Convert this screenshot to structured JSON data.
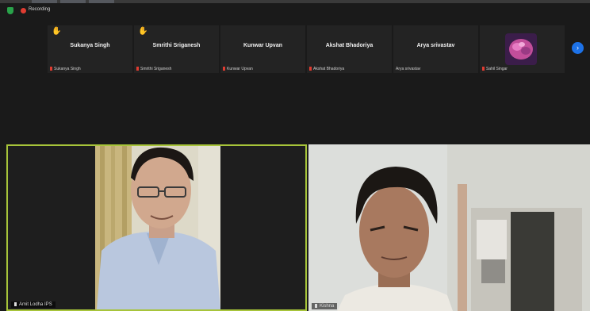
{
  "window": {
    "recording_label": "Recording"
  },
  "participants": [
    {
      "name": "Sukanya Singh",
      "caption": "Sukanya Singh",
      "hand_raised": true,
      "has_avatar": false
    },
    {
      "name": "Smrithi Sriganesh",
      "caption": "Smrithi Sriganesh",
      "hand_raised": true,
      "has_avatar": false
    },
    {
      "name": "Kunwar Upvan",
      "caption": "Kunwar Upvan",
      "hand_raised": false,
      "has_avatar": false
    },
    {
      "name": "Akshat Bhadoriya",
      "caption": "Akshat Bhadoriya",
      "hand_raised": false,
      "has_avatar": false
    },
    {
      "name": "Arya srivastav",
      "caption": "Arya srivastav",
      "hand_raised": false,
      "has_avatar": false
    },
    {
      "name": "",
      "caption": "Sahil Singar",
      "hand_raised": false,
      "has_avatar": true
    }
  ],
  "video_tiles": {
    "left_label": "Amit Lodha IPS",
    "right_label": "Kishna"
  },
  "icons": {
    "security": "shield-icon",
    "recording": "record-dot-icon",
    "raised_hand": "raised-hand-icon",
    "muted": "mic-muted-icon",
    "next": "chevron-right-icon"
  },
  "colors": {
    "active_speaker_border": "#a7c43a",
    "record": "#e03c31",
    "accent": "#1d72e8",
    "muted": "#e03c31"
  }
}
